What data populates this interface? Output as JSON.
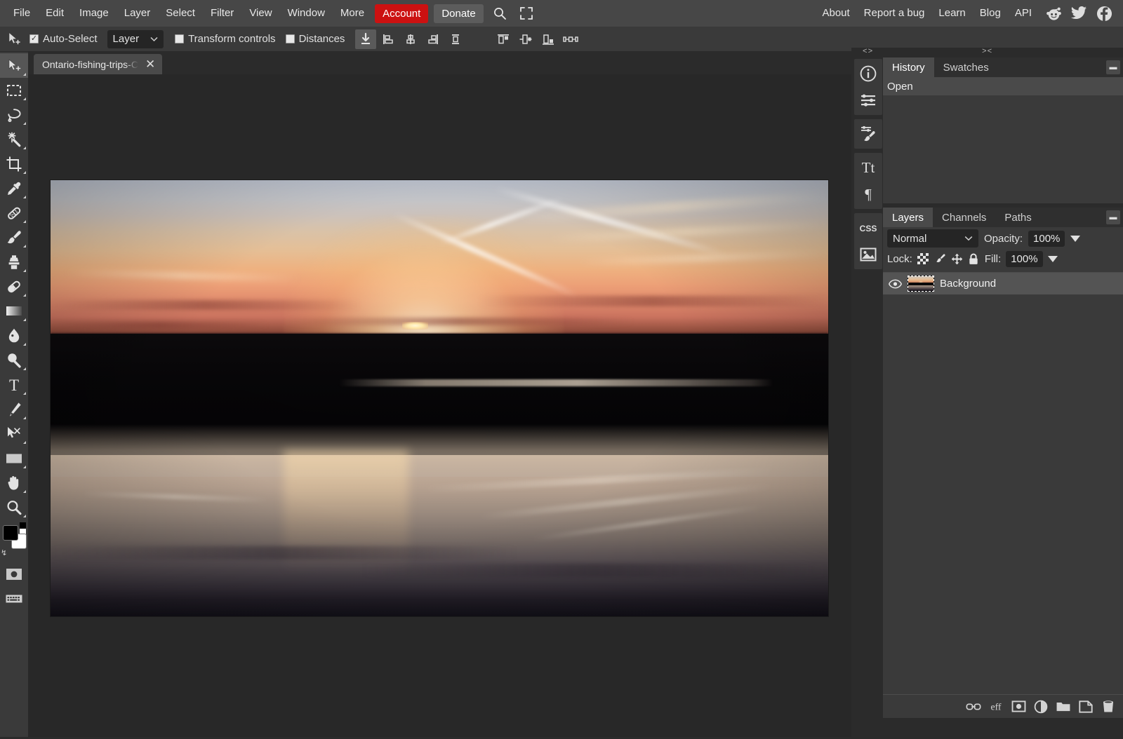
{
  "menubar": {
    "items": [
      "File",
      "Edit",
      "Image",
      "Layer",
      "Select",
      "Filter",
      "View",
      "Window",
      "More"
    ],
    "account_label": "Account",
    "donate_label": "Donate",
    "account_color": "#cc1111",
    "search_icon": "search-icon",
    "fullscreen_icon": "fullscreen-icon",
    "right_items": [
      "About",
      "Report a bug",
      "Learn",
      "Blog",
      "API"
    ],
    "social": [
      "reddit-icon",
      "twitter-icon",
      "facebook-icon"
    ]
  },
  "options": {
    "tool_icon": "move-tool-icon",
    "auto_select_label": "Auto-Select",
    "auto_select_checked": true,
    "layer_select_value": "Layer",
    "transform_controls_label": "Transform controls",
    "transform_controls_checked": false,
    "distances_label": "Distances",
    "distances_checked": false,
    "align_buttons": [
      "align-download-icon",
      "align-left-icon",
      "align-center-horizontal-icon",
      "align-right-icon",
      "distribute-vertical-icon",
      "align-top-icon",
      "align-middle-icon",
      "align-bottom-icon",
      "distribute-horizontal-icon"
    ]
  },
  "tabs": {
    "documents": [
      {
        "name": "Ontario-fishing-trips-C",
        "close_label": "✕",
        "active": true
      }
    ]
  },
  "toolbar": {
    "tools": [
      {
        "name": "move-tool",
        "icon": "move-tool-icon",
        "active": true
      },
      {
        "name": "rectangular-marquee-tool",
        "icon": "marquee-icon",
        "active": false
      },
      {
        "name": "lasso-tool",
        "icon": "lasso-icon",
        "active": false
      },
      {
        "name": "magic-wand-tool",
        "icon": "magic-wand-icon",
        "active": false
      },
      {
        "name": "crop-tool",
        "icon": "crop-icon",
        "active": false
      },
      {
        "name": "eyedropper-tool",
        "icon": "eyedropper-icon",
        "active": false
      },
      {
        "name": "healing-brush-tool",
        "icon": "healing-brush-icon",
        "active": false
      },
      {
        "name": "brush-tool",
        "icon": "brush-icon",
        "active": false
      },
      {
        "name": "clone-stamp-tool",
        "icon": "clone-stamp-icon",
        "active": false
      },
      {
        "name": "eraser-tool",
        "icon": "eraser-icon",
        "active": false
      },
      {
        "name": "gradient-tool",
        "icon": "gradient-icon",
        "active": false
      },
      {
        "name": "blur-tool",
        "icon": "blur-droplet-icon",
        "active": false
      },
      {
        "name": "dodge-tool",
        "icon": "dodge-icon",
        "active": false
      },
      {
        "name": "type-tool",
        "icon": "type-icon",
        "active": false
      },
      {
        "name": "pen-tool",
        "icon": "pen-icon",
        "active": false
      },
      {
        "name": "path-select-tool",
        "icon": "path-select-icon",
        "active": false
      },
      {
        "name": "shape-tool",
        "icon": "rectangle-shape-icon",
        "active": false
      },
      {
        "name": "hand-tool",
        "icon": "hand-icon",
        "active": false
      },
      {
        "name": "zoom-tool",
        "icon": "magnifier-icon",
        "active": false
      }
    ],
    "foreground_color": "#000000",
    "background_color": "#ffffff",
    "quick_mask_icon": "quick-mask-icon",
    "screen_mode_icon": "keyboard-icon"
  },
  "right_panel": {
    "collapse_left": "<>",
    "collapse_right": "><",
    "icon_column": [
      "info-icon",
      "adjustments-icon",
      "brush-settings-icon",
      "character-icon",
      "paragraph-icon",
      "css-icon",
      "image-icon"
    ],
    "history_panel": {
      "tabs": [
        {
          "label": "History",
          "active": true
        },
        {
          "label": "Swatches",
          "active": false
        }
      ],
      "menu_icon": "panel-menu-icon",
      "entries": [
        "Open"
      ]
    },
    "layers_panel": {
      "tabs": [
        {
          "label": "Layers",
          "active": true
        },
        {
          "label": "Channels",
          "active": false
        },
        {
          "label": "Paths",
          "active": false
        }
      ],
      "menu_icon": "panel-menu-icon",
      "blend_mode": "Normal",
      "opacity_label": "Opacity:",
      "opacity_value": "100%",
      "fill_label": "Fill:",
      "fill_value": "100%",
      "lock_label": "Lock:",
      "lock_icons": [
        "lock-transparency-icon",
        "lock-paint-icon",
        "lock-position-icon",
        "lock-all-icon"
      ],
      "layers": [
        {
          "name": "Background",
          "visible": true,
          "selected": true,
          "visibility_icon": "eye-icon"
        }
      ],
      "footer_icons": [
        "link-layers-icon",
        "layer-effects-icon",
        "add-mask-icon",
        "adjustment-layer-icon",
        "new-group-icon",
        "new-layer-icon",
        "delete-layer-icon"
      ],
      "footer_effects_label": "eff"
    }
  },
  "canvas": {
    "image_description": "sunset-over-lake-photo"
  }
}
